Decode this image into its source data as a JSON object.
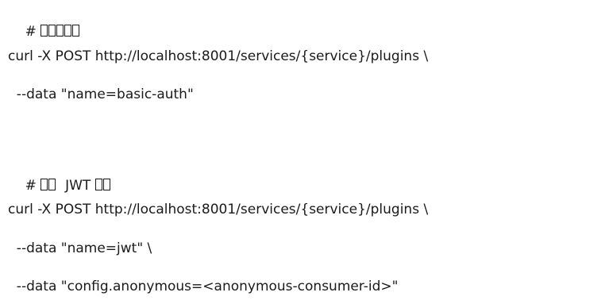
{
  "code": {
    "comment1_prefix": "# ",
    "comment1_placeholder_glyphs": 5,
    "line2": "curl -X POST http://localhost:8001/services/{service}/plugins \\",
    "line3": "  --data \"name=basic-auth\"",
    "comment2_prefix": "# ",
    "comment2_placeholder_glyphs_a": 2,
    "comment2_middle": "  JWT ",
    "comment2_placeholder_glyphs_b": 2,
    "line6": "curl -X POST http://localhost:8001/services/{service}/plugins \\",
    "line7": "  --data \"name=jwt\" \\",
    "line8": "  --data \"config.anonymous=<anonymous-consumer-id>\""
  }
}
